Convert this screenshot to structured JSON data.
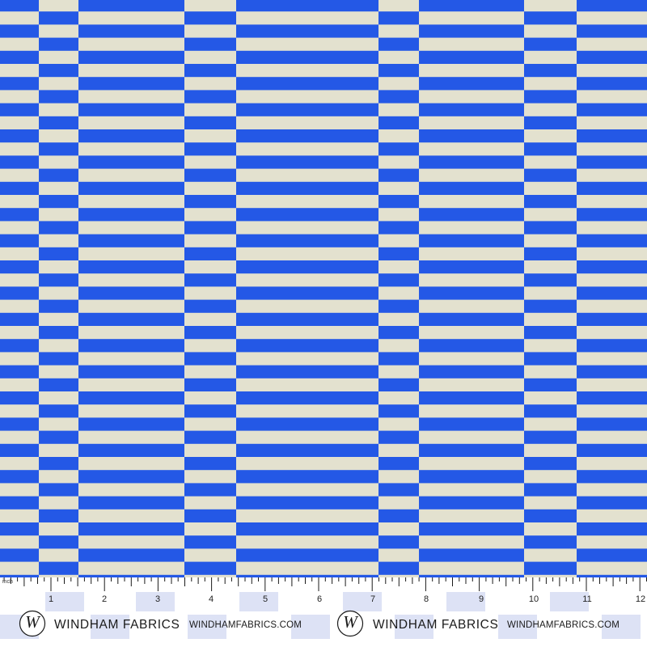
{
  "fabric": {
    "colors": {
      "blue": "#2458e6",
      "cream": "#e3e1cf"
    },
    "stripe_pattern": "alternating horizontal blue and cream stripes; neighbouring vertical columns are offset by half a stripe"
  },
  "ruler": {
    "unit_label": "inch",
    "numbers": [
      "1",
      "2",
      "3",
      "4",
      "5",
      "6",
      "7",
      "8",
      "9",
      "10",
      "11",
      "12"
    ],
    "logo_letter": "W",
    "brand_name": "WINDHAM FABRICS",
    "website": "WINDHAMFABRICS.COM",
    "colors": {
      "band": "#dde2f5",
      "ink": "#1b1b1b"
    }
  }
}
